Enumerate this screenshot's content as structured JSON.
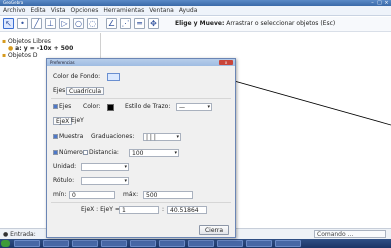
{
  "window": {
    "title": "GeoGebra"
  },
  "menu": {
    "items": [
      "Archivo",
      "Edita",
      "Vista",
      "Opciones",
      "Herramientas",
      "Ventana",
      "Ayuda"
    ]
  },
  "toolbar": {
    "tool_icons": [
      "pointer-tool-icon",
      "point-tool-icon",
      "line-tool-icon",
      "perpendicular-tool-icon",
      "polygon-tool-icon",
      "circle-tool-icon",
      "conic-tool-icon",
      "angle-tool-icon",
      "reflect-tool-icon",
      "slider-tool-icon",
      "move-view-tool-icon"
    ],
    "hint_bold": "Elige y Mueve:",
    "hint_text": "Arrastrar o seleccionar objetos (Esc)"
  },
  "algebra": {
    "free_objects": "Objetos Libres",
    "equation": "a: y = -10x + 500",
    "dependent_objects": "Objetos D"
  },
  "dialog": {
    "title": "Preferencias",
    "background_color_label": "Color de Fondo:",
    "tabs": [
      "Ejes",
      "Cuadrícula"
    ],
    "axes_label": "Ejes",
    "color_label": "Color:",
    "line_style_label": "Estilo de Trazo:",
    "line_style_value": "—",
    "axis_tabs": [
      "EjeX",
      "EjeY"
    ],
    "show_label": "Muestra",
    "ticks_label": "Graduaciones:",
    "ticks_value": "| | |",
    "number_label": "Número",
    "distance_label": "Distancia:",
    "distance_value": "100",
    "unit_label": "Unidad:",
    "unit_value": "",
    "label_label": "Rótulo:",
    "label_value": "",
    "min_label": "mín:",
    "min_value": "0",
    "max_label": "máx:",
    "max_value": "500",
    "ratio_label": "EjeX : EjeY =",
    "ratio_left": "1",
    "ratio_right": "40.51864",
    "close_button": "Cierra"
  },
  "bottom": {
    "input_label": "Entrada:",
    "command_placeholder": "Comando ..."
  },
  "taskbar": {
    "items": [
      "",
      "",
      "",
      "",
      "",
      "",
      "",
      "",
      "",
      ""
    ],
    "clock": ""
  },
  "colors": {
    "accent": "#3c6fd1",
    "titlebar": "#3a6aa9",
    "axis_color": "#000000"
  }
}
